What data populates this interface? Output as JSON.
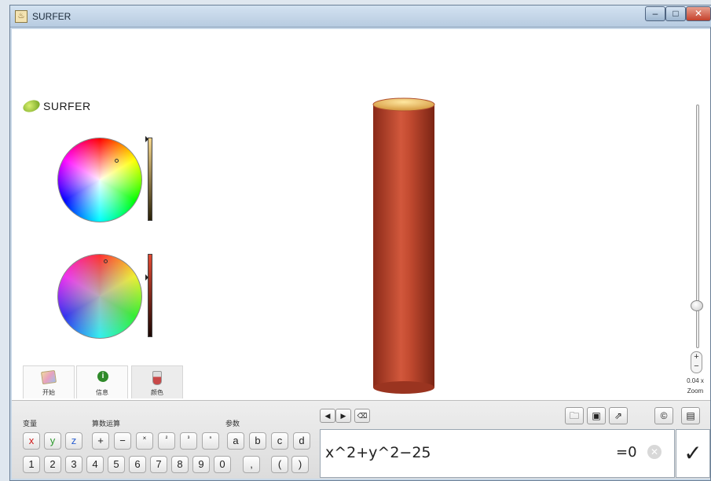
{
  "window": {
    "title": "SURFER",
    "app_icon": "java-cup-icon",
    "controls": {
      "minimize": "–",
      "maximize": "□",
      "close": "✕"
    }
  },
  "sidebar": {
    "logo_text": "SURFER",
    "color_pickers": [
      {
        "name": "outside-color",
        "slider_color_top": "#f5d68c"
      },
      {
        "name": "inside-color",
        "slider_color_top": "#e24a33"
      }
    ],
    "tabs": [
      {
        "label": "开始",
        "icon": "start-images-icon"
      },
      {
        "label": "信息",
        "icon": "info-icon",
        "glyph": "i"
      },
      {
        "label": "颜色",
        "icon": "paint-bucket-icon"
      }
    ]
  },
  "surface": {
    "outside_color": "#c8462e",
    "inside_color": "#f2c866",
    "zoom_value": "0.04 x",
    "zoom_label": "Zoom",
    "zoom_stepper": "+\n−"
  },
  "keyboard": {
    "groups": {
      "variables": "变量",
      "operations": "算数运算",
      "parameters": "参数"
    },
    "variable_keys": [
      "x",
      "y",
      "z"
    ],
    "operator_keys": [
      "+",
      "−",
      "×",
      "²",
      "³",
      "ⁿ"
    ],
    "parameter_keys": [
      "a",
      "b",
      "c",
      "d"
    ],
    "number_keys": [
      "1",
      "2",
      "3",
      "4",
      "5",
      "6",
      "7",
      "8",
      "9",
      "0",
      ",",
      "(",
      ")"
    ]
  },
  "toolbar": {
    "left_arrow": "◀",
    "right_arrow": "▶",
    "backspace": "⌫",
    "open": "open-folder-icon",
    "save": "save-disk-icon",
    "export": "export-icon",
    "copyright": "©",
    "gallery": "gallery-icon"
  },
  "formula": {
    "value": "x^2+y^2−25",
    "suffix": "=0",
    "clear_glyph": "✕",
    "confirm_glyph": "✓"
  }
}
